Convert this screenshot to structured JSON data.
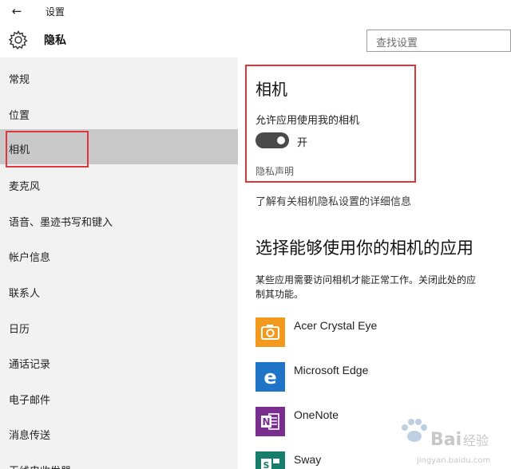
{
  "window": {
    "title": "设置",
    "back_icon": "back-arrow-icon"
  },
  "header": {
    "title": "隐私",
    "gear_icon": "gear-icon",
    "search_placeholder": "查找设置"
  },
  "sidebar": {
    "items": [
      {
        "label": "常规"
      },
      {
        "label": "位置"
      },
      {
        "label": "相机",
        "selected": true
      },
      {
        "label": "麦克风"
      },
      {
        "label": "语音、墨迹书写和键入"
      },
      {
        "label": "帐户信息"
      },
      {
        "label": "联系人"
      },
      {
        "label": "日历"
      },
      {
        "label": "通话记录"
      },
      {
        "label": "电子邮件"
      },
      {
        "label": "消息传送"
      },
      {
        "label": "无线电收发器"
      }
    ]
  },
  "main": {
    "section_title": "相机",
    "allow_label": "允许应用使用我的相机",
    "toggle": {
      "on": true,
      "state_label": "开"
    },
    "privacy_link": "隐私声明",
    "learn_more": "了解有关相机隐私设置的详细信息",
    "apps_heading": "选择能够使用你的相机的应用",
    "apps_desc_line1": "某些应用需要访问相机才能正常工作。关闭此处的应",
    "apps_desc_line2": "制其功能。",
    "apps": [
      {
        "name": "Acer Crystal Eye",
        "icon": "camera-app-icon",
        "color": "#f39a1e"
      },
      {
        "name": "Microsoft Edge",
        "icon": "edge-icon",
        "color": "#1f74c8"
      },
      {
        "name": "OneNote",
        "icon": "onenote-icon",
        "color": "#7a2f8e"
      },
      {
        "name": "Sway",
        "icon": "sway-icon",
        "color": "#177e6b"
      }
    ]
  },
  "colors": {
    "highlight": "#e0363a",
    "sidebar_bg": "#f2f2f2",
    "selected_bg": "#c9c9c9",
    "toggle_on": "#4a4a4a"
  },
  "watermark": {
    "logo_text": "Bai du 经验",
    "sub_text": "jingyan.baidu.com"
  }
}
